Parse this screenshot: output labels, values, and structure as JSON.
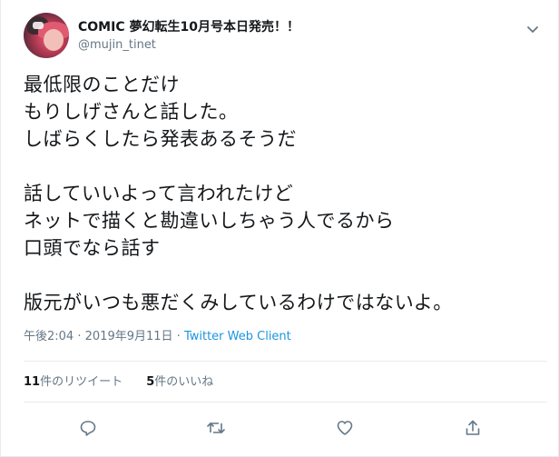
{
  "user": {
    "display_name": "COMIC 夢幻転生10月号本日発売！！",
    "screen_name": "@mujin_tinet"
  },
  "tweet": {
    "text": "最低限のことだけ\nもりしげさんと話した。\nしばらくしたら発表あるそうだ\n\n話していいよって言われたけど\nネットで描くと勘違いしちゃう人でるから\n口頭でなら話す\n\n版元がいつも悪だくみしているわけではないよ。"
  },
  "meta": {
    "time": "午後2:04",
    "separator": "·",
    "date": "2019年9月11日",
    "client": "Twitter Web Client"
  },
  "stats": {
    "retweets_count": "11",
    "retweets_label": "件のリツイート",
    "likes_count": "5",
    "likes_label": "件のいいね"
  },
  "icons": {
    "caret": "chevron-down-icon",
    "reply": "reply-icon",
    "retweet": "retweet-icon",
    "like": "heart-icon",
    "share": "share-icon"
  },
  "colors": {
    "text": "#14171a",
    "secondary": "#657786",
    "link": "#1b95e0",
    "border": "#e6ecf0"
  }
}
